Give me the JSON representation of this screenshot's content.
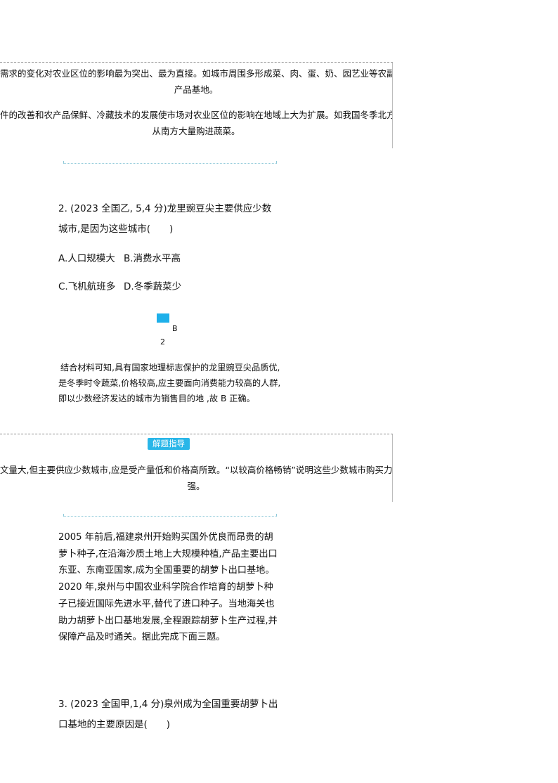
{
  "tip1": {
    "lines": [
      "需求的变化对农业区位的影响最为突出、最为直接。如城市周围多形成菜、肉、蛋、奶、园艺业等农副",
      "产品基地。",
      "件的改善和农产品保鲜、冷藏技术的发展使市场对农业区位的影响在地域上大为扩展。如我国冬季北方",
      "从南方大量购进蔬菜。"
    ]
  },
  "q2": {
    "stem_line1": "2. (2023 全国乙, 5,4 分)龙里豌豆尖主要供应少数",
    "stem_line2": "城市,是因为这些城市(　　)",
    "option_a": "A.人口规模大",
    "option_b": "B.消费水平高",
    "option_c": "C.飞机航班多",
    "option_d": "D.冬季蔬菜少"
  },
  "answer": {
    "letter": "B",
    "number": "2"
  },
  "explanation": "结合材料可知,具有国家地理标志保护的龙里豌豆尖品质优,是冬季时令蔬菜,价格较高,应主要面向消费能力较高的人群,即以少数经济发达的城市为销售目的地 ,故 B 正确。",
  "tip2": {
    "badge": "解题指导",
    "lines": [
      "文量大,但主要供应少数城市,应是受产量低和价格高所致。“以较高价格畅销”说明这些少数城市购买力",
      "强。"
    ]
  },
  "material": "2005 年前后,福建泉州开始购买国外优良而昂贵的胡萝卜种子,在沿海沙质土地上大规模种植,产品主要出口东亚、东南亚国家,成为全国重要的胡萝卜出口基地。2020 年,泉州与中国农业科学院合作培育的胡萝卜种子已接近国际先进水平,替代了进口种子。当地海关也助力胡萝卜出口基地发展,全程跟踪胡萝卜生产过程,并保障产品及时通关。据此完成下面三题。",
  "q3": {
    "stem_line1": "3. (2023 全国甲,1,4 分)泉州成为全国重要胡萝卜出",
    "stem_line2": "口基地的主要原因是(　　)"
  }
}
